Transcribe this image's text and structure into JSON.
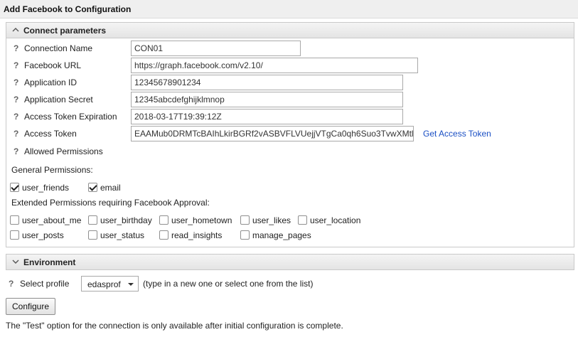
{
  "page": {
    "title": "Add Facebook to Configuration"
  },
  "connect": {
    "header": "Connect parameters",
    "fields": [
      {
        "label": "Connection Name",
        "value": "CON01"
      },
      {
        "label": "Facebook URL",
        "value": "https://graph.facebook.com/v2.10/"
      },
      {
        "label": "Application ID",
        "value": "12345678901234"
      },
      {
        "label": "Application Secret",
        "value": "12345abcdefghijklmnop"
      },
      {
        "label": "Access Token Expiration",
        "value": "2018-03-17T19:39:12Z"
      },
      {
        "label": "Access Token",
        "value": "EAAMub0DRMTcBAIhLkirBGRf2vASBVFLVUejjVTgCa0qh6Suo3TvwXMtl"
      }
    ],
    "get_token_link": "Get Access Token",
    "allowed_permissions_label": "Allowed Permissions",
    "general_label": "General Permissions:",
    "general": [
      {
        "label": "user_friends",
        "checked": true
      },
      {
        "label": "email",
        "checked": true
      }
    ],
    "extended_label": "Extended Permissions requiring Facebook Approval:",
    "extended": [
      {
        "label": "user_about_me",
        "checked": false
      },
      {
        "label": "user_birthday",
        "checked": false
      },
      {
        "label": "user_hometown",
        "checked": false
      },
      {
        "label": "user_likes",
        "checked": false
      },
      {
        "label": "user_location",
        "checked": false
      },
      {
        "label": "user_posts",
        "checked": false
      },
      {
        "label": "user_status",
        "checked": false
      },
      {
        "label": "read_insights",
        "checked": false
      },
      {
        "label": "manage_pages",
        "checked": false
      }
    ],
    "help_glyph": "?"
  },
  "environment": {
    "header": "Environment",
    "profile_label": "Select profile",
    "profile_value": "edasprof",
    "profile_hint": "(type in a new one or select one from the list)"
  },
  "footer": {
    "configure_label": "Configure",
    "note": "The \"Test\" option for the connection is only available after initial configuration is complete."
  },
  "icons": {
    "collapse": "chevron-up-icon",
    "expand": "chevron-down-icon",
    "help": "question-mark-icon",
    "dropdown": "caret-down-icon"
  },
  "colors": {
    "link": "#1a4fc4",
    "header_bg": "#efefef"
  }
}
